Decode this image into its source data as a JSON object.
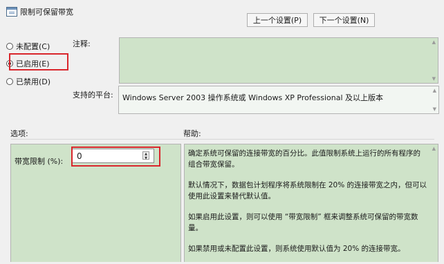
{
  "window": {
    "title": "限制可保留带宽"
  },
  "nav": {
    "prev_label": "上一个设置(P)",
    "next_label": "下一个设置(N)"
  },
  "state": {
    "options": [
      {
        "label": "未配置(C)",
        "selected": false
      },
      {
        "label": "已启用(E)",
        "selected": true
      },
      {
        "label": "已禁用(D)",
        "selected": false
      }
    ]
  },
  "comment": {
    "label": "注释:",
    "value": ""
  },
  "platform": {
    "label": "支持的平台:",
    "value": "Windows Server 2003 操作系统或 Windows XP Professional 及以上版本"
  },
  "sections": {
    "options_label": "选项:",
    "help_label": "帮助:"
  },
  "bandwidth": {
    "label": "带宽限制 (%):",
    "value": "0"
  },
  "help": {
    "paragraphs": [
      "确定系统可保留的连接带宽的百分比。此值限制系统上运行的所有程序的组合带宽保留。",
      "默认情况下，数据包计划程序将系统限制在 20% 的连接带宽之内，但可以使用此设置来替代默认值。",
      "如果启用此设置，则可以使用 “带宽限制” 框来调整系统可保留的带宽数量。",
      "如果禁用或未配置此设置，则系统使用默认值为 20% 的连接带宽。"
    ]
  },
  "colors": {
    "highlight_red": "#d9262c",
    "panel_green": "#cfe3c9"
  }
}
